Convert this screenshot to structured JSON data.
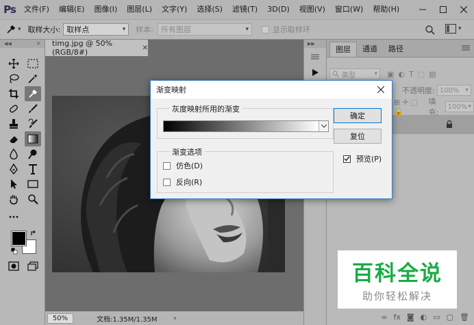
{
  "app": {
    "logo": "Ps"
  },
  "menu": [
    "文件(F)",
    "编辑(E)",
    "图像(I)",
    "图层(L)",
    "文字(Y)",
    "选择(S)",
    "滤镜(T)",
    "3D(D)",
    "视图(V)",
    "窗口(W)",
    "帮助(H)"
  ],
  "options_bar": {
    "sample_size_label": "取样大小:",
    "sample_size_value": "取样点",
    "sample_label": "样本:",
    "sample_value": "所有图层",
    "show_ring_label": "显示取样环"
  },
  "document": {
    "tab_title": "timg.jpg @ 50%(RGB/8#)",
    "zoom": "50%",
    "doc_info": "文档:1.35M/1.35M"
  },
  "layers_panel": {
    "tabs": [
      "图层",
      "通道",
      "路径"
    ],
    "filter_label": "类型",
    "opacity_label": "不透明度:",
    "opacity_value": "100%",
    "fill_label": "填充:",
    "fill_value": "100%"
  },
  "dialog": {
    "title": "渐变映射",
    "gradient_group_title": "灰度映射所用的渐变",
    "options_group_title": "渐变选项",
    "dither_label": "仿色(D)",
    "reverse_label": "反向(R)",
    "ok_label": "确定",
    "reset_label": "复位",
    "preview_label": "预览(P)",
    "preview_checked": true,
    "gradient_colors": [
      "#000000",
      "#ffffff"
    ]
  },
  "watermark": {
    "title": "百科全说",
    "subtitle": "助你轻松解决",
    "color": "#1aac46"
  }
}
